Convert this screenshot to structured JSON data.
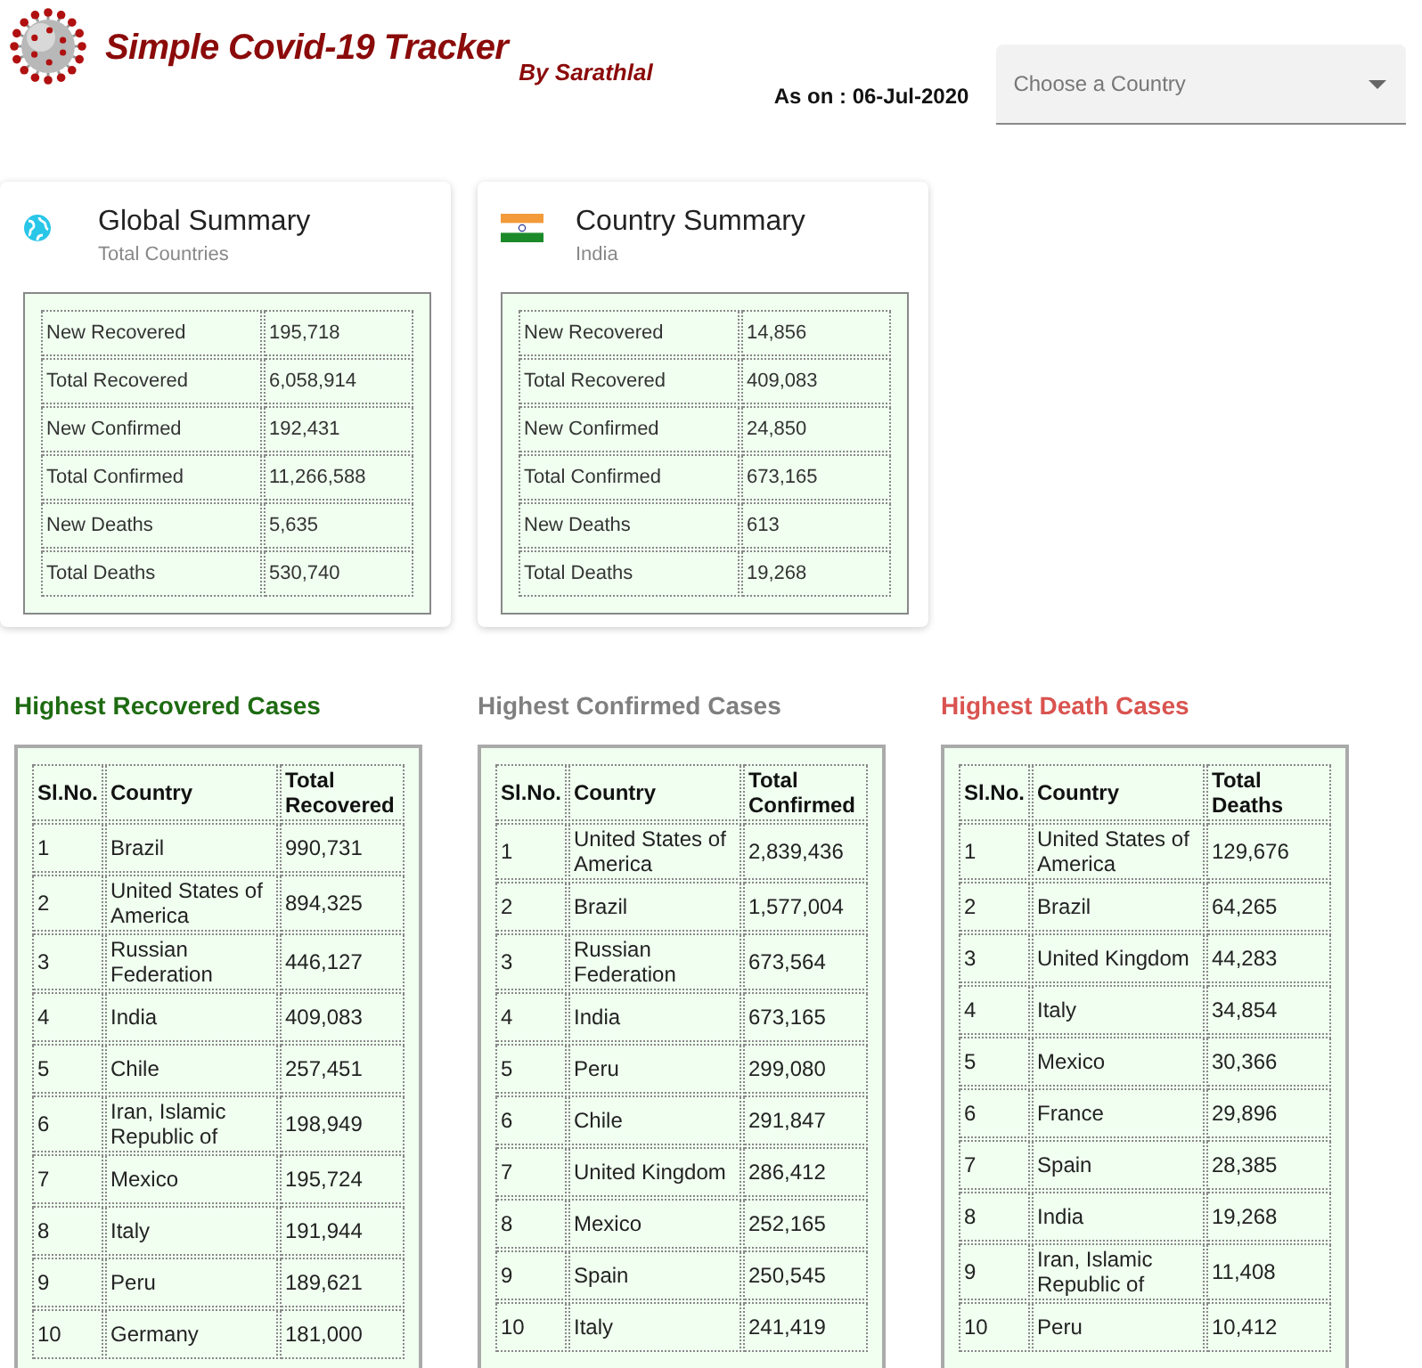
{
  "header": {
    "title": "Simple Covid-19 Tracker",
    "byline": "By Sarathlal",
    "date": "As on : 06-Jul-2020",
    "country_select": {
      "placeholder": "Choose a Country"
    }
  },
  "summaries": [
    {
      "kind": "global",
      "title": "Global Summary",
      "subtitle": "Total Countries",
      "rows": [
        [
          "New Recovered",
          "195,718"
        ],
        [
          "Total Recovered",
          "6,058,914"
        ],
        [
          "New Confirmed",
          "192,431"
        ],
        [
          "Total Confirmed",
          "11,266,588"
        ],
        [
          "New Deaths",
          "5,635"
        ],
        [
          "Total Deaths",
          "530,740"
        ]
      ]
    },
    {
      "kind": "country",
      "title": "Country Summary",
      "subtitle": "India",
      "rows": [
        [
          "New Recovered",
          "14,856"
        ],
        [
          "Total Recovered",
          "409,083"
        ],
        [
          "New Confirmed",
          "24,850"
        ],
        [
          "Total Confirmed",
          "673,165"
        ],
        [
          "New Deaths",
          "613"
        ],
        [
          "Total Deaths",
          "19,268"
        ]
      ]
    }
  ],
  "rankings": [
    {
      "title": "Highest Recovered Cases",
      "color": "#1e6b12",
      "columns": [
        "Sl.No.",
        "Country",
        "Total Recovered"
      ],
      "rows": [
        [
          "1",
          "Brazil",
          "990,731"
        ],
        [
          "2",
          "United States of America",
          "894,325"
        ],
        [
          "3",
          "Russian Federation",
          "446,127"
        ],
        [
          "4",
          "India",
          "409,083"
        ],
        [
          "5",
          "Chile",
          "257,451"
        ],
        [
          "6",
          "Iran, Islamic Republic of",
          "198,949"
        ],
        [
          "7",
          "Mexico",
          "195,724"
        ],
        [
          "8",
          "Italy",
          "191,944"
        ],
        [
          "9",
          "Peru",
          "189,621"
        ],
        [
          "10",
          "Germany",
          "181,000"
        ]
      ]
    },
    {
      "title": "Highest Confirmed Cases",
      "color": "#7f7f7f",
      "columns": [
        "Sl.No.",
        "Country",
        "Total Confirmed"
      ],
      "rows": [
        [
          "1",
          "United States of America",
          "2,839,436"
        ],
        [
          "2",
          "Brazil",
          "1,577,004"
        ],
        [
          "3",
          "Russian Federation",
          "673,564"
        ],
        [
          "4",
          "India",
          "673,165"
        ],
        [
          "5",
          "Peru",
          "299,080"
        ],
        [
          "6",
          "Chile",
          "291,847"
        ],
        [
          "7",
          "United Kingdom",
          "286,412"
        ],
        [
          "8",
          "Mexico",
          "252,165"
        ],
        [
          "9",
          "Spain",
          "250,545"
        ],
        [
          "10",
          "Italy",
          "241,419"
        ]
      ]
    },
    {
      "title": "Highest Death Cases",
      "color": "#d9534f",
      "columns": [
        "Sl.No.",
        "Country",
        "Total Deaths"
      ],
      "rows": [
        [
          "1",
          "United States of America",
          "129,676"
        ],
        [
          "2",
          "Brazil",
          "64,265"
        ],
        [
          "3",
          "United Kingdom",
          "44,283"
        ],
        [
          "4",
          "Italy",
          "34,854"
        ],
        [
          "5",
          "Mexico",
          "30,366"
        ],
        [
          "6",
          "France",
          "29,896"
        ],
        [
          "7",
          "Spain",
          "28,385"
        ],
        [
          "8",
          "India",
          "19,268"
        ],
        [
          "9",
          "Iran, Islamic Republic of",
          "11,408"
        ],
        [
          "10",
          "Peru",
          "10,412"
        ]
      ]
    }
  ]
}
